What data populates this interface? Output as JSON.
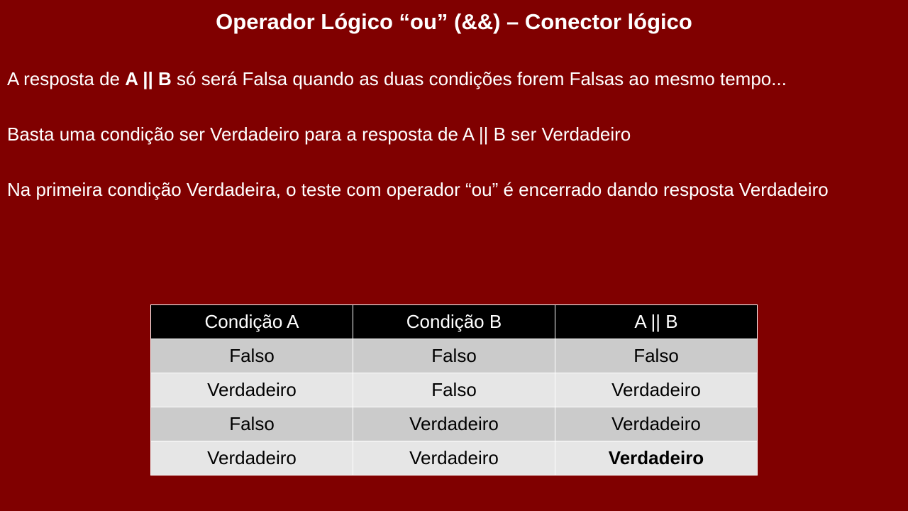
{
  "title": "Operador Lógico “ou” (&&) – Conector lógico",
  "paragraph1": {
    "before": "A resposta de ",
    "expr": "A || B",
    "after": " só será Falsa quando as duas condições forem Falsas ao mesmo tempo..."
  },
  "paragraph2": "Basta uma condição ser Verdadeiro para a resposta de A || B ser Verdadeiro",
  "paragraph3": "Na primeira condição Verdadeira, o teste com operador “ou” é encerrado dando resposta Verdadeiro",
  "table": {
    "headers": [
      "Condição A",
      "Condição B",
      "A || B"
    ],
    "rows": [
      [
        "Falso",
        "Falso",
        "Falso"
      ],
      [
        "Verdadeiro",
        "Falso",
        "Verdadeiro"
      ],
      [
        "Falso",
        "Verdadeiro",
        "Verdadeiro"
      ],
      [
        "Verdadeiro",
        "Verdadeiro",
        "Verdadeiro"
      ]
    ]
  },
  "colors": {
    "background": "#800000",
    "header_bg": "#000000",
    "row_odd": "#cbcbcb",
    "row_even": "#e6e6e6"
  }
}
